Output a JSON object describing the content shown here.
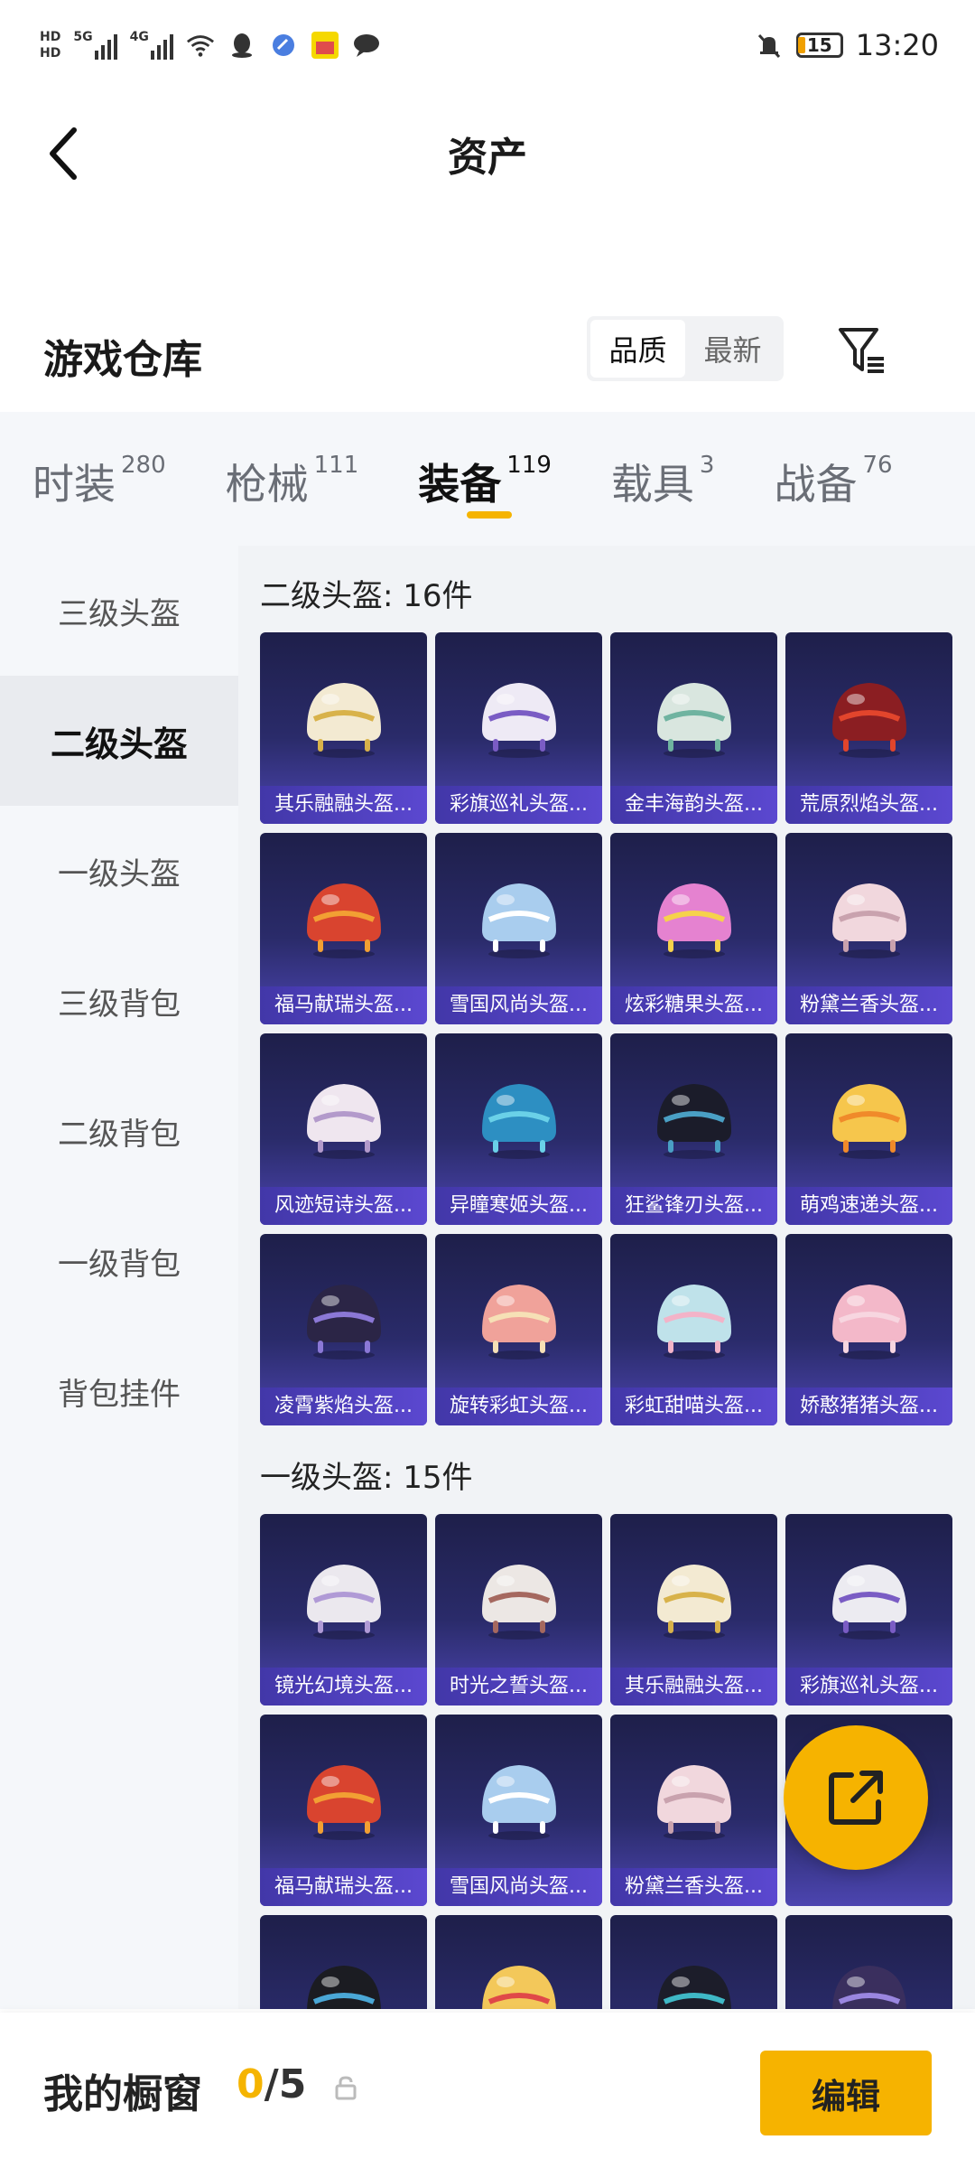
{
  "status_bar": {
    "time": "13:20",
    "battery": "15",
    "network_1": "5G",
    "network_2": "4G",
    "hd1": "HD",
    "hd2": "HD"
  },
  "title_bar": {
    "title": "资产",
    "back_icon": "chevron-left-icon"
  },
  "warehouse": {
    "title": "游戏仓库",
    "sort": {
      "options": [
        "品质",
        "最新"
      ],
      "selected": "品质"
    },
    "filter_icon": "filter-icon"
  },
  "tabs": [
    {
      "label": "时装",
      "count": "280"
    },
    {
      "label": "枪械",
      "count": "111"
    },
    {
      "label": "装备",
      "count": "119",
      "active": true
    },
    {
      "label": "载具",
      "count": "3"
    },
    {
      "label": "战备",
      "count": "76"
    }
  ],
  "sidebar": {
    "items": [
      "三级头盔",
      "二级头盔",
      "一级头盔",
      "三级背包",
      "二级背包",
      "一级背包",
      "背包挂件"
    ],
    "active": "二级头盔"
  },
  "groups": [
    {
      "title": "二级头盔: 16件",
      "items": [
        {
          "name": "其乐融融头盔...",
          "color": "#f3ead2",
          "accent": "#d8b24a"
        },
        {
          "name": "彩旗巡礼头盔...",
          "color": "#eeeaf5",
          "accent": "#7a5cc4"
        },
        {
          "name": "金丰海韵头盔...",
          "color": "#d9e6df",
          "accent": "#6fb3a0"
        },
        {
          "name": "荒原烈焰头盔...",
          "color": "#8b1e22",
          "accent": "#e2452c"
        },
        {
          "name": "福马献瑞头盔...",
          "color": "#d9442f",
          "accent": "#f2a033"
        },
        {
          "name": "雪国风尚头盔...",
          "color": "#a9cdee",
          "accent": "#ffffff"
        },
        {
          "name": "炫彩糖果头盔...",
          "color": "#e582d0",
          "accent": "#f6d24b"
        },
        {
          "name": "粉黛兰香头盔...",
          "color": "#f1d7dd",
          "accent": "#c9a2ae"
        },
        {
          "name": "风迹短诗头盔...",
          "color": "#efe6ef",
          "accent": "#b39acb"
        },
        {
          "name": "异瞳寒姬头盔...",
          "color": "#2d8fc2",
          "accent": "#6ad1e8"
        },
        {
          "name": "狂鲨锋刃头盔...",
          "color": "#1b1c2a",
          "accent": "#4a9fc4"
        },
        {
          "name": "萌鸡速递头盔...",
          "color": "#f6c64c",
          "accent": "#f08a2a"
        },
        {
          "name": "凌霄紫焰头盔...",
          "color": "#2b2546",
          "accent": "#8b78d6"
        },
        {
          "name": "旋转彩虹头盔...",
          "color": "#f0a29a",
          "accent": "#f6e0b6"
        },
        {
          "name": "彩虹甜喵头盔...",
          "color": "#bfe2ea",
          "accent": "#f3b3c8"
        },
        {
          "name": "娇憨猪猪头盔...",
          "color": "#f3b8c9",
          "accent": "#f7d6e0"
        }
      ]
    },
    {
      "title": "一级头盔: 15件",
      "items": [
        {
          "name": "镜光幻境头盔...",
          "color": "#ebe8ee",
          "accent": "#b09ad6"
        },
        {
          "name": "时光之誓头盔...",
          "color": "#ece7e4",
          "accent": "#a5685f"
        },
        {
          "name": "其乐融融头盔...",
          "color": "#f3ead2",
          "accent": "#d8b24a"
        },
        {
          "name": "彩旗巡礼头盔...",
          "color": "#ecebf1",
          "accent": "#7a5cc4"
        },
        {
          "name": "福马献瑞头盔...",
          "color": "#d9442f",
          "accent": "#f2a033"
        },
        {
          "name": "雪国风尚头盔...",
          "color": "#a9cdee",
          "accent": "#ffffff"
        },
        {
          "name": "粉黛兰香头盔...",
          "color": "#f1d7dd",
          "accent": "#c9a2ae"
        },
        {
          "name": "",
          "color": "#f1d7dd",
          "accent": "#c9a2ae"
        },
        {
          "name": "",
          "color": "#1b1c22",
          "accent": "#4aa7d6"
        },
        {
          "name": "",
          "color": "#f3c85a",
          "accent": "#e04848"
        },
        {
          "name": "",
          "color": "#1c1d2a",
          "accent": "#3fb8c6"
        },
        {
          "name": "",
          "color": "#3a2f5e",
          "accent": "#9a86e0"
        }
      ]
    }
  ],
  "fab": {
    "icon": "share-external-icon"
  },
  "bottom_bar": {
    "label": "我的橱窗",
    "current": "0",
    "sep": "/",
    "total": "5",
    "lock_icon": "lock-icon",
    "edit_label": "编辑"
  },
  "colors": {
    "accent": "#f6b300",
    "card_bg": "#22235a",
    "card_label": "#4f40c0"
  }
}
